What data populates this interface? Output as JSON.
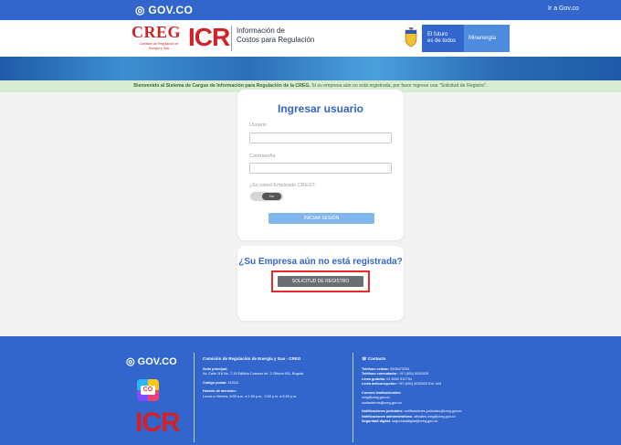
{
  "gov_bar": {
    "logo": "GOV.CO",
    "link": "Ir a Gov.co"
  },
  "brand": {
    "creg_name": "CREG",
    "creg_subtitle": "Comisión de Regulación de Energía y Gas",
    "icr_logo": "ICR",
    "icr_line1": "Información de",
    "icr_line2": "Costos para Regulación",
    "futuro_line1": "El futuro",
    "futuro_line2": "es de todos",
    "ministry": "Minenergía"
  },
  "welcome": {
    "bold": "Bienvenido al Sistema de Cargue de Información para Regulación de la CREG.",
    "rest": " Si su empresa aún no está registrada, por favor ingrese una \"Solicitud de Registro\"."
  },
  "login": {
    "title": "Ingresar usuario",
    "username_label": "Usuario",
    "username_value": "",
    "password_label": "Contraseña",
    "password_value": "",
    "employee_label": "¿Es usted Empleado CREG?:",
    "toggle_value": "No",
    "submit_label": "INICIAR SESIÓN"
  },
  "register": {
    "title": "¿Su Empresa aún no está registrada?",
    "button_label": "SOLICITUD DE REGISTRO"
  },
  "footer": {
    "logo": "GOV.CO",
    "co_badge": "CO",
    "icr_logo": "ICR",
    "entity": "Comisión de Regulación de Energía y Gas - CREG",
    "sede_label": "Sede principal:",
    "sede_value": "Av. Calle 116 No. 7-15 Edificio Cusezar Int. 2 Oficina 901, Bogotá",
    "postal_label": "Código postal:",
    "postal_value": "110111",
    "hours_label": "Horario de atención:",
    "hours_value": "Lunes a Viernes, 8:00 a.m. a 1:00 p.m., 2:00 p.m. a 5:00 p.m.",
    "contact_title": "Contacto",
    "cell_label": "Teléfono celular:",
    "cell_value": "3208473254",
    "switch_label": "Teléfono conmutador:",
    "switch_value": "+57 (601) 6032020",
    "free_label": "Línea gratuita:",
    "free_value": "01 8000 512734",
    "anticorr_label": "Línea anticorrupción:",
    "anticorr_value": "+57 (601) 6032020 Ext. 444",
    "emails_label": "Correos Institucionales:",
    "email1": "creg@creg.gov.co",
    "email2": "contactenos@creg.gov.co",
    "judicial_label": "Notificaciones judiciales:",
    "judicial_value": "notificaciones.judiciales@creg.gov.co",
    "admin_label": "Notificaciones administrativas:",
    "admin_value": "oficiales.creg@creg.gov.co",
    "digital_label": "Seguridad digital:",
    "digital_value": "seguridaddigital@creg.gov.co"
  }
}
